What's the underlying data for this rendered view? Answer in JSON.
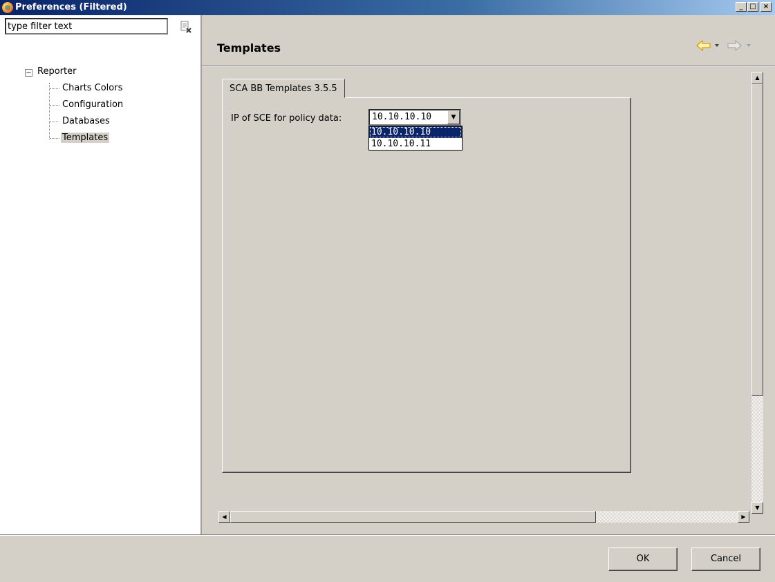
{
  "window": {
    "title": "Preferences (Filtered)",
    "minimize_label": "_",
    "maximize_label": "□",
    "close_label": "×"
  },
  "filter": {
    "value": "type filter text"
  },
  "tree": {
    "expander": "−",
    "root": "Reporter",
    "children": [
      "Charts Colors",
      "Configuration",
      "Databases",
      "Templates"
    ],
    "selected": "Templates"
  },
  "page": {
    "title": "Templates",
    "tab_label": "SCA BB Templates 3.5.5",
    "ip_label": "IP of SCE for policy data:",
    "ip_value": "10.10.10.10",
    "ip_options": [
      "10.10.10.10",
      "10.10.10.11"
    ]
  },
  "buttons": {
    "ok": "OK",
    "cancel": "Cancel"
  },
  "colors": {
    "titlebar": "#0a246a",
    "selection": "#0a246a",
    "nav_back": "#f5b400"
  }
}
